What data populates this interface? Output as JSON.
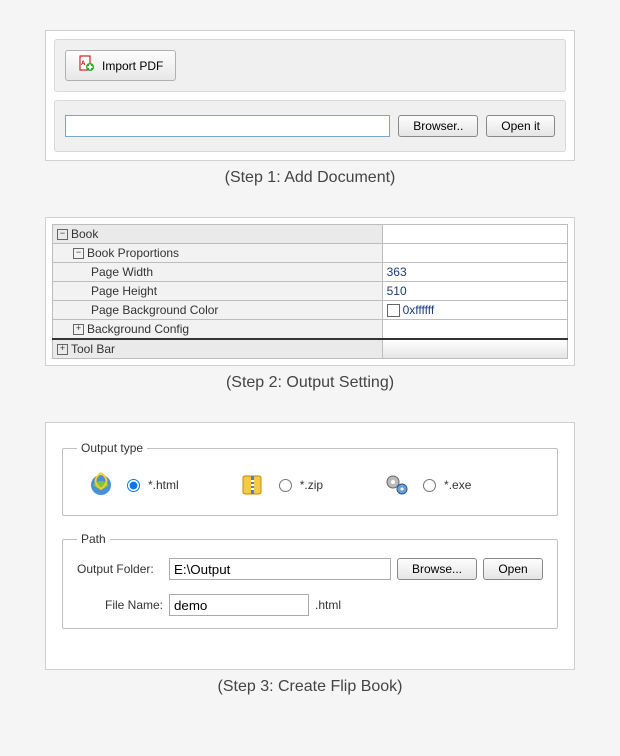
{
  "step1": {
    "import_label": "Import PDF",
    "path_value": "",
    "browser_label": "Browser..",
    "open_label": "Open it",
    "caption": "(Step 1: Add Document)"
  },
  "step2": {
    "tree": {
      "book": "Book",
      "book_proportions": "Book Proportions",
      "page_width": {
        "label": "Page Width",
        "value": "363"
      },
      "page_height": {
        "label": "Page Height",
        "value": "510"
      },
      "page_bg": {
        "label": "Page Background Color",
        "value": "0xffffff"
      },
      "background_config": "Background Config",
      "tool_bar": "Tool Bar"
    },
    "caption": "(Step 2: Output Setting)"
  },
  "step3": {
    "output_type_legend": "Output type",
    "html_label": "*.html",
    "zip_label": "*.zip",
    "exe_label": "*.exe",
    "path_legend": "Path",
    "output_folder_label": "Output Folder:",
    "output_folder_value": "E:\\Output",
    "browse_label": "Browse...",
    "open_label": "Open",
    "file_name_label": "File Name:",
    "file_name_value": "demo",
    "file_ext": ".html",
    "caption": "(Step 3: Create Flip Book)"
  }
}
